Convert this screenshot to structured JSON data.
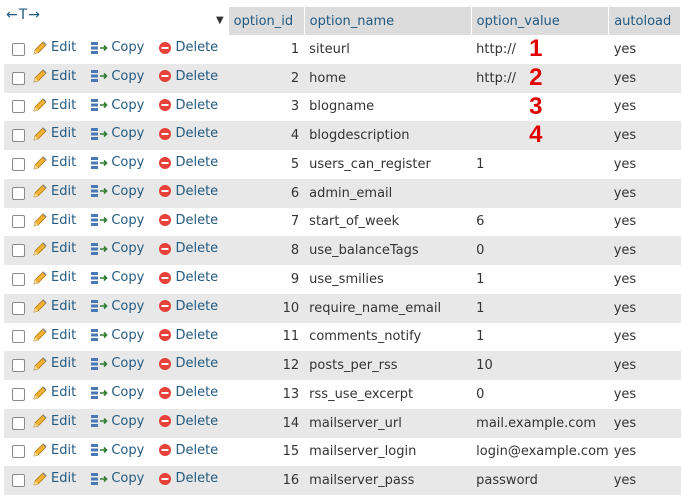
{
  "header": {
    "nav_arrows": "←T→",
    "columns": [
      {
        "label": "option_id"
      },
      {
        "label": "option_name"
      },
      {
        "label": "option_value"
      },
      {
        "label": "autoload"
      }
    ]
  },
  "actions": {
    "edit": "Edit",
    "copy": "Copy",
    "delete": "Delete"
  },
  "rows": [
    {
      "option_id": "1",
      "option_name": "siteurl",
      "option_value": "http://",
      "autoload": "yes",
      "badge": "1"
    },
    {
      "option_id": "2",
      "option_name": "home",
      "option_value": "http://",
      "autoload": "yes",
      "badge": "2"
    },
    {
      "option_id": "3",
      "option_name": "blogname",
      "option_value": "",
      "autoload": "yes",
      "badge": "3"
    },
    {
      "option_id": "4",
      "option_name": "blogdescription",
      "option_value": "",
      "autoload": "yes",
      "badge": "4"
    },
    {
      "option_id": "5",
      "option_name": "users_can_register",
      "option_value": "1",
      "autoload": "yes"
    },
    {
      "option_id": "6",
      "option_name": "admin_email",
      "option_value": "",
      "autoload": "yes"
    },
    {
      "option_id": "7",
      "option_name": "start_of_week",
      "option_value": "6",
      "autoload": "yes"
    },
    {
      "option_id": "8",
      "option_name": "use_balanceTags",
      "option_value": "0",
      "autoload": "yes"
    },
    {
      "option_id": "9",
      "option_name": "use_smilies",
      "option_value": "1",
      "autoload": "yes"
    },
    {
      "option_id": "10",
      "option_name": "require_name_email",
      "option_value": "1",
      "autoload": "yes"
    },
    {
      "option_id": "11",
      "option_name": "comments_notify",
      "option_value": "1",
      "autoload": "yes"
    },
    {
      "option_id": "12",
      "option_name": "posts_per_rss",
      "option_value": "10",
      "autoload": "yes"
    },
    {
      "option_id": "13",
      "option_name": "rss_use_excerpt",
      "option_value": "0",
      "autoload": "yes"
    },
    {
      "option_id": "14",
      "option_name": "mailserver_url",
      "option_value": "mail.example.com",
      "autoload": "yes"
    },
    {
      "option_id": "15",
      "option_name": "mailserver_login",
      "option_value": "login@example.com",
      "autoload": "yes"
    },
    {
      "option_id": "16",
      "option_name": "mailserver_pass",
      "option_value": "password",
      "autoload": "yes"
    }
  ],
  "colors": {
    "link": "#235a81",
    "header_bg": "#dcdcdc",
    "row_alt": "#e8e8e8",
    "badge": "#e00000",
    "delete_icon": "#e8413a"
  },
  "icons": {
    "edit": "pencil-icon",
    "copy": "copy-icon",
    "delete": "delete-icon",
    "sort": "sort-caret-icon"
  }
}
